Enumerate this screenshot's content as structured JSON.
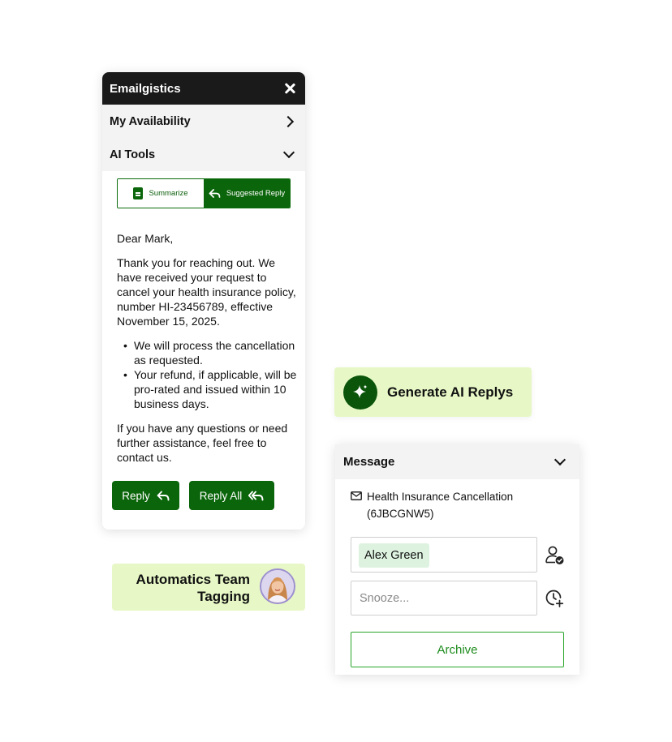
{
  "panel": {
    "title": "Emailgistics",
    "menu": {
      "availability": "My Availability",
      "ai_tools": "AI Tools"
    },
    "tabs": {
      "summarize": "Summarize",
      "suggested_reply": "Suggested Reply",
      "active": "Suggested Reply"
    },
    "letter": {
      "greeting": "Dear Mark,",
      "paragraph1": "Thank you for reaching out. We have received your request to cancel your health insurance policy, number HI-23456789, effective November 15, 2025.",
      "bullets": [
        "We will process the cancellation as requested.",
        "Your refund, if applicable, will be pro-rated and issued within 10 business days."
      ],
      "paragraph2": "If you have any questions or need further assistance, feel free to contact us."
    },
    "buttons": {
      "reply": "Reply",
      "reply_all": "Reply All"
    }
  },
  "badges": {
    "generate": "Generate AI Replys",
    "team_tagging_line1": "Automatics Team",
    "team_tagging_line2": "Tagging"
  },
  "message_panel": {
    "title": "Message",
    "subject_line1": "Health Insurance Cancellation",
    "subject_line2": "(6JBCGNW5)",
    "assignee": "Alex Green",
    "snooze_placeholder": "Snooze...",
    "archive": "Archive"
  },
  "colors": {
    "brand_green": "#0b650b",
    "badge_bg": "#e7f8c6",
    "header_dark": "#1a1a1a",
    "chip_bg": "#ddf3e0",
    "archive_green": "#2aa52a"
  },
  "icons": {
    "close": "close-icon",
    "availability": "chevron-right-icon",
    "ai_tools": "chevron-down-icon",
    "summarize": "document-icon",
    "suggested_reply": "reply-arrow-icon",
    "reply_all": "reply-all-arrow-icon",
    "generate": "sparkle-icon",
    "subject": "envelope-icon",
    "assign": "user-check-icon",
    "snooze": "clock-plus-icon"
  }
}
